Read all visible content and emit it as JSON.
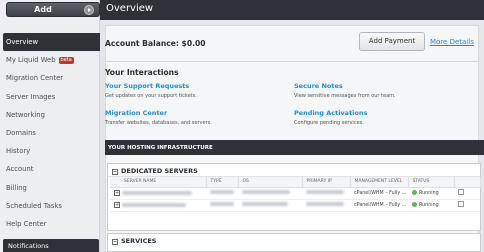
{
  "sidebar": {
    "add_label": "Add",
    "items": [
      {
        "label": "Overview",
        "active": true
      },
      {
        "label": "My Liquid Web",
        "badge": "beta"
      },
      {
        "label": "Migration Center"
      },
      {
        "label": "Server Images"
      },
      {
        "label": "Networking"
      },
      {
        "label": "Domains"
      },
      {
        "label": "History"
      },
      {
        "label": "Account"
      },
      {
        "label": "Billing"
      },
      {
        "label": "Scheduled Tasks"
      },
      {
        "label": "Help Center"
      }
    ],
    "notifications_label": "Notifications"
  },
  "header": {
    "title": "Overview"
  },
  "account": {
    "balance_label": "Account Balance: $0.00",
    "add_payment_label": "Add Payment",
    "more_details_label": "More Details"
  },
  "interactions": {
    "title": "Your Interactions",
    "items": [
      {
        "title": "Your Support Requests",
        "desc": "Get updates on your support tickets."
      },
      {
        "title": "Secure Notes",
        "desc": "View sensitive messages from our team."
      },
      {
        "title": "Migration Center",
        "desc": "Transfer websites, databases, and servers."
      },
      {
        "title": "Pending Activations",
        "desc": "Configure pending services."
      }
    ]
  },
  "infrastructure": {
    "title": "YOUR HOSTING INFRASTRUCTURE",
    "dedicated": {
      "title": "DEDICATED SERVERS",
      "columns": [
        "SERVER NAME",
        "TYPE",
        "OS",
        "PRIMARY IP",
        "MANAGEMENT LEVEL",
        "STATUS"
      ],
      "rows": [
        {
          "management": "cPanel/WHM – Fully ...",
          "status": "Running"
        },
        {
          "management": "cPanel/WHM – Fully ...",
          "status": "Running"
        }
      ]
    },
    "services": {
      "title": "SERVICES"
    }
  },
  "colors": {
    "dark": "#2e3238",
    "link": "#1f8fd8",
    "running": "#5cb85c",
    "beta": "#c0392b"
  }
}
